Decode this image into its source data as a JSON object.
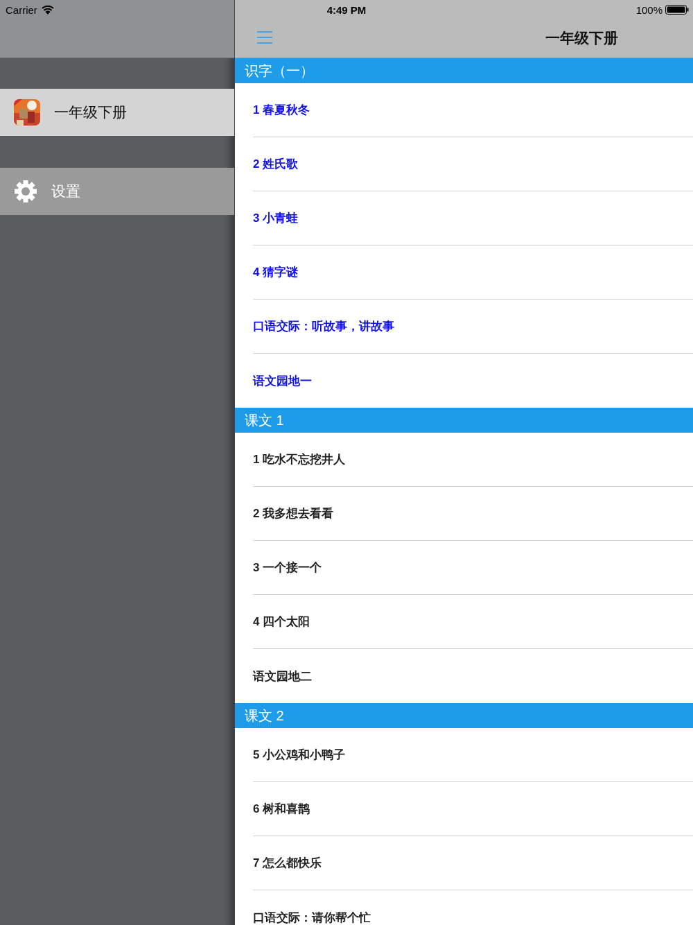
{
  "status_bar": {
    "carrier": "Carrier",
    "time": "4:49 PM",
    "battery": "100%"
  },
  "sidebar": {
    "items": [
      {
        "label": "一年级下册",
        "kind": "picture",
        "selected": true
      },
      {
        "label": "设置",
        "kind": "gear",
        "selected": false
      }
    ]
  },
  "nav_bar": {
    "title": "一年级下册"
  },
  "sections": [
    {
      "title": "识字（一）",
      "rows": [
        {
          "label": "1 春夏秋冬",
          "highlighted": true
        },
        {
          "label": "2 姓氏歌",
          "highlighted": true
        },
        {
          "label": "3 小青蛙",
          "highlighted": true
        },
        {
          "label": "4 猜字谜",
          "highlighted": true
        },
        {
          "label": "口语交际：听故事，讲故事",
          "highlighted": true
        },
        {
          "label": "语文园地一",
          "highlighted": true
        }
      ]
    },
    {
      "title": "课文 1",
      "rows": [
        {
          "label": "1 吃水不忘挖井人",
          "highlighted": false
        },
        {
          "label": "2 我多想去看看",
          "highlighted": false
        },
        {
          "label": "3 一个接一个",
          "highlighted": false
        },
        {
          "label": "4 四个太阳",
          "highlighted": false
        },
        {
          "label": "语文园地二",
          "highlighted": false
        }
      ]
    },
    {
      "title": "课文 2",
      "rows": [
        {
          "label": "5 小公鸡和小鸭子",
          "highlighted": false
        },
        {
          "label": "6 树和喜鹊",
          "highlighted": false
        },
        {
          "label": "7 怎么都快乐",
          "highlighted": false
        },
        {
          "label": "口语交际：请你帮个忙",
          "highlighted": false
        }
      ]
    }
  ]
}
